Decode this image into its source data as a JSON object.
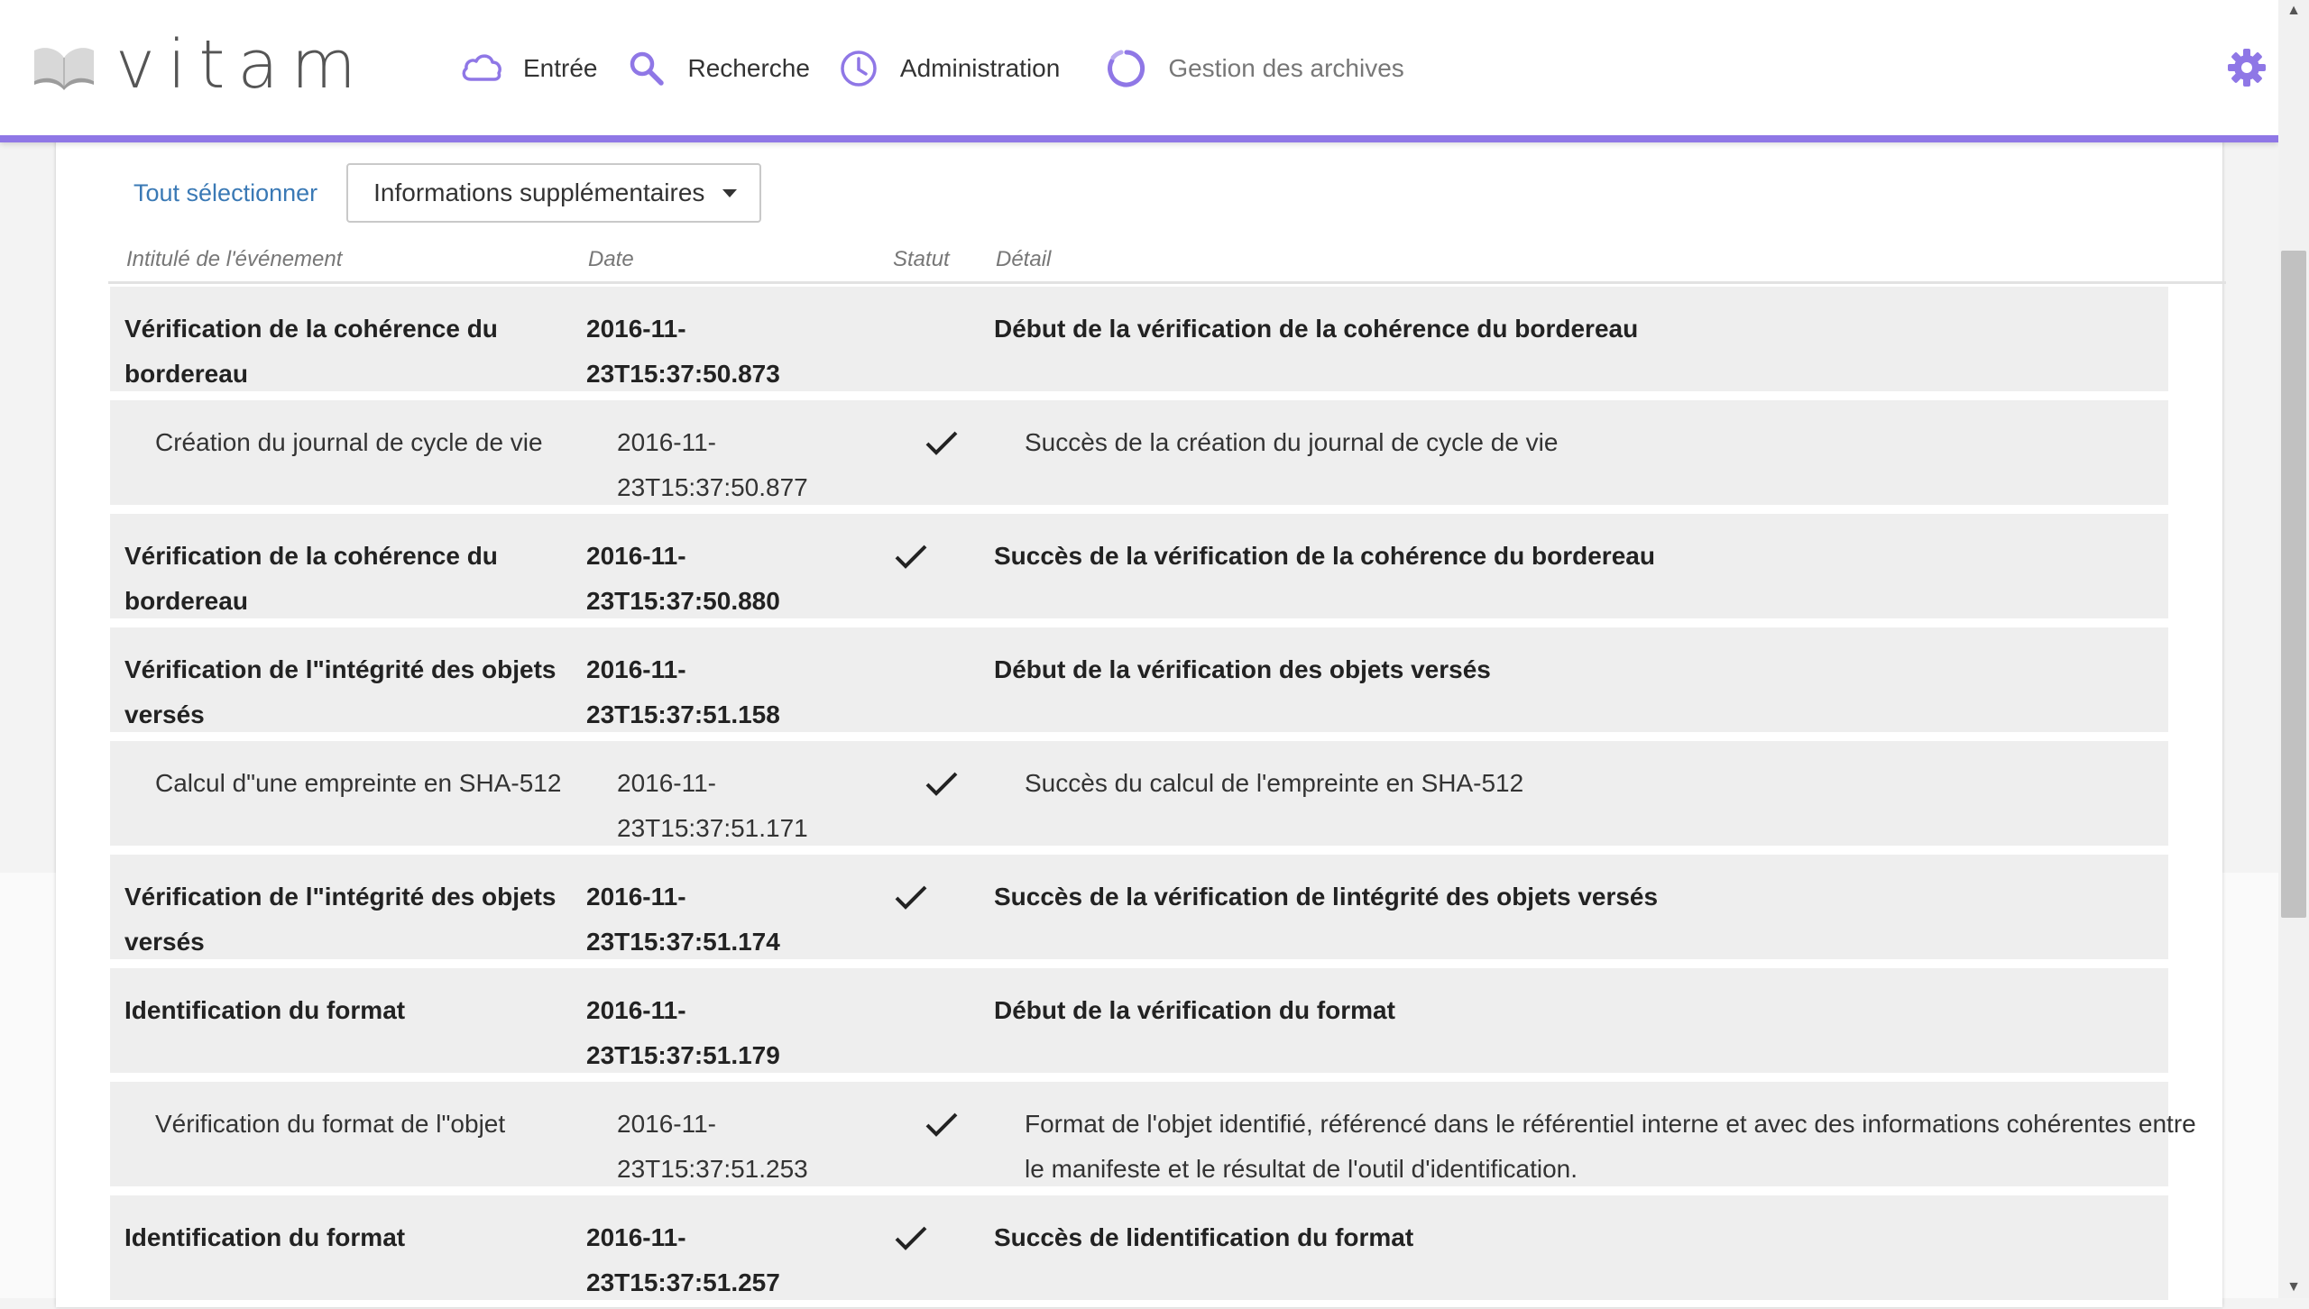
{
  "app": {
    "logo_text": "vitam"
  },
  "nav": [
    {
      "label": "Entrée",
      "icon": "cloud-icon"
    },
    {
      "label": "Recherche",
      "icon": "search-icon"
    },
    {
      "label": "Administration",
      "icon": "clock-icon"
    },
    {
      "label": "Gestion des archives",
      "icon": "refresh-icon"
    }
  ],
  "colors": {
    "accent": "#8f77e6",
    "link": "#3a79b5",
    "row_bg": "#eeeeee"
  },
  "toolbar": {
    "select_all": "Tout sélectionner",
    "dropdown_value": "Informations supplémentaires"
  },
  "table": {
    "headers": {
      "title": "Intitulé de l'événement",
      "date": "Date",
      "status": "Statut",
      "detail": "Détail"
    },
    "rows": [
      {
        "level": "parent",
        "title": "Vérification de la cohérence du bordereau",
        "date": "2016-11-23T15:37:50.873",
        "ok": false,
        "detail": "Début de la vérification de la cohérence du bordereau"
      },
      {
        "level": "child",
        "title": "Création du journal de cycle de vie",
        "date": "2016-11-23T15:37:50.877",
        "ok": true,
        "detail": "Succès de la création du journal de cycle de vie"
      },
      {
        "level": "parent",
        "title": "Vérification de la cohérence du bordereau",
        "date": "2016-11-23T15:37:50.880",
        "ok": true,
        "detail": "Succès de la vérification de la cohérence du bordereau"
      },
      {
        "level": "parent",
        "title": "Vérification de l\"intégrité des objets versés",
        "date": "2016-11-23T15:37:51.158",
        "ok": false,
        "detail": "Début de la vérification des objets versés"
      },
      {
        "level": "child",
        "title": "Calcul d\"une empreinte en SHA-512",
        "date": "2016-11-23T15:37:51.171",
        "ok": true,
        "detail": "Succès du calcul de l'empreinte en SHA-512"
      },
      {
        "level": "parent",
        "title": "Vérification de l\"intégrité des objets versés",
        "date": "2016-11-23T15:37:51.174",
        "ok": true,
        "detail": "Succès de la vérification de lintégrité des objets versés"
      },
      {
        "level": "parent",
        "title": "Identification du format",
        "date": "2016-11-23T15:37:51.179",
        "ok": false,
        "detail": "Début de la vérification du format"
      },
      {
        "level": "child",
        "title": "Vérification du format de l\"objet",
        "date": "2016-11-23T15:37:51.253",
        "ok": true,
        "detail": "Format de l'objet identifié, référencé dans le référentiel interne et avec des informations cohérentes entre le manifeste et le résultat de l'outil d'identification."
      },
      {
        "level": "parent",
        "title": "Identification du format",
        "date": "2016-11-23T15:37:51.257",
        "ok": true,
        "detail": "Succès de lidentification du format"
      }
    ]
  }
}
